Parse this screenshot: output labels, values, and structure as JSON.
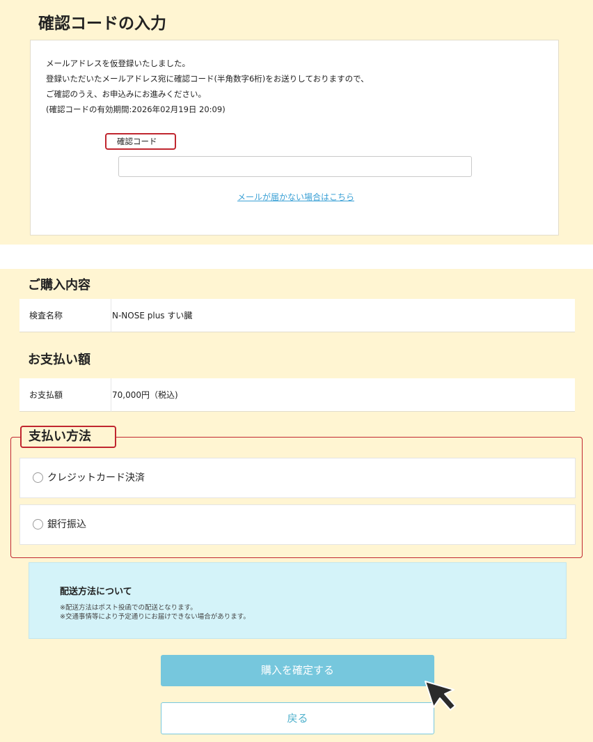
{
  "header": {
    "title": "確認コードの入力"
  },
  "verify": {
    "message_lines": [
      "メールアドレスを仮登録いたしました。",
      "登録いただいたメールアドレス宛に確認コード(半角数字6桁)をお送りしておりますので、",
      "ご確認のうえ、お申込みにお進みください。",
      "(確認コードの有効期間:2026年02月19日 20:09)"
    ],
    "code_label": "確認コード",
    "code_value": "",
    "mail_link": "メールが届かない場合はこちら"
  },
  "purchase": {
    "title": "ご購入内容",
    "label": "検査名称",
    "value": "N-NOSE plus すい臓"
  },
  "payment_amount": {
    "title": "お支払い額",
    "label": "お支払額",
    "value": "70,000円（税込)"
  },
  "payment_method": {
    "title": "支払い方法",
    "options": [
      "クレジットカード決済",
      "銀行振込"
    ]
  },
  "shipping": {
    "title": "配送方法について",
    "notes": [
      "※配送方法はポスト投函での配送となります。",
      "※交通事情等により予定通りにお届けできない場合があります。"
    ]
  },
  "buttons": {
    "confirm": "購入を確定する",
    "back": "戻る"
  },
  "colors": {
    "background": "#fff5d2",
    "highlight": "#c0262f",
    "accent": "#76c7dd",
    "link": "#3aa0d5",
    "info_box": "#d4f3f9"
  }
}
